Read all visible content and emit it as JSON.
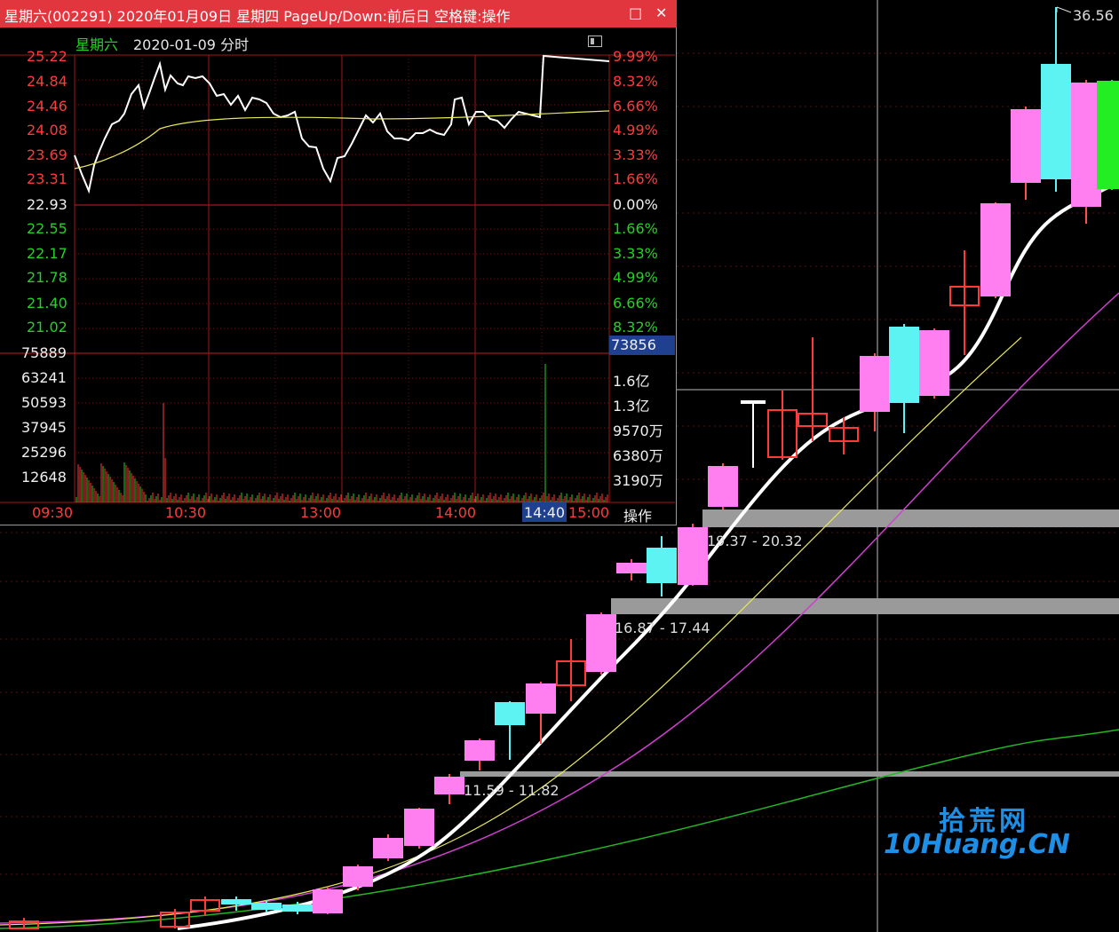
{
  "kline": {
    "peak_label": "36.56",
    "zones": [
      {
        "label": "19.37 - 20.32"
      },
      {
        "label": "16.87 - 17.44"
      },
      {
        "label": "11.59 - 11.82"
      }
    ]
  },
  "popup": {
    "title": "星期六(002291) 2020年01月09日 星期四 PageUp/Down:前后日 空格键:操作",
    "restore_icon": "□",
    "close_icon": "✕",
    "sub_day": "星期六",
    "sub_date": "2020-01-09 分时",
    "price_labels_up": [
      "25.22",
      "24.84",
      "24.46",
      "24.08",
      "23.69",
      "23.31"
    ],
    "price_base": "22.93",
    "price_labels_down": [
      "22.55",
      "22.17",
      "21.78",
      "21.40",
      "21.02"
    ],
    "pct_labels_up": [
      "9.99%",
      "8.32%",
      "6.66%",
      "4.99%",
      "3.33%",
      "1.66%"
    ],
    "pct_base": "0.00%",
    "pct_labels_down": [
      "1.66%",
      "3.33%",
      "4.99%",
      "6.66%",
      "8.32%"
    ],
    "volume_labels": [
      "75889",
      "63241",
      "50593",
      "37945",
      "25296",
      "12648"
    ],
    "amount_labels": [
      "73856",
      "1.6亿",
      "1.3亿",
      "9570万",
      "6380万",
      "3190万"
    ],
    "time_labels": [
      "09:30",
      "10:30",
      "13:00",
      "14:00",
      "14:40",
      "15:00",
      "操作"
    ]
  },
  "logo": {
    "cn": "拾荒网",
    "en": "10Huang.CN"
  },
  "colors": {
    "up": "#ff3a3a",
    "down": "#22d322",
    "accent_bar": "#e2363f",
    "candle_up": "#ff7ef0",
    "candle_down": "#5ef3f3",
    "ma5": "#ffffff",
    "ma10": "#e8e85a",
    "ma20": "#d040d0",
    "ma60": "#22b822"
  }
}
